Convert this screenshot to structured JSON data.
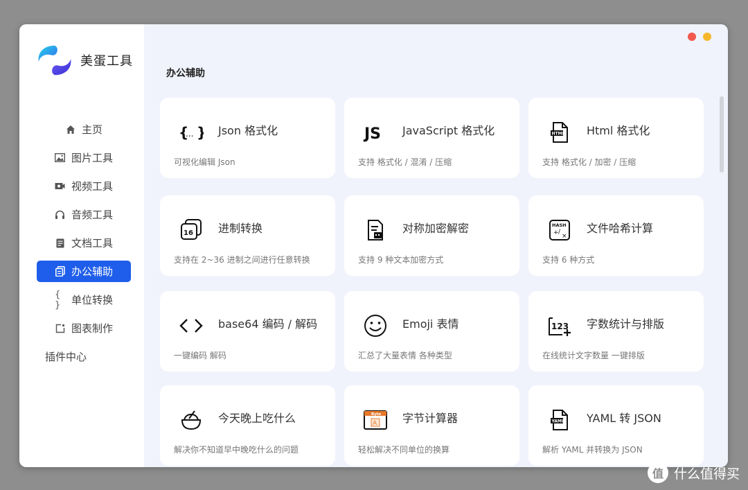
{
  "app": {
    "name": "美蛋工具"
  },
  "window_controls": {
    "close_color": "#f2584e",
    "minimize_color": "#f5b82d"
  },
  "sidebar": {
    "items": [
      {
        "label": "主页",
        "icon": "home-icon"
      },
      {
        "label": "图片工具",
        "icon": "image-icon"
      },
      {
        "label": "视频工具",
        "icon": "video-icon"
      },
      {
        "label": "音频工具",
        "icon": "headphones-icon"
      },
      {
        "label": "文档工具",
        "icon": "document-icon"
      },
      {
        "label": "办公辅助",
        "icon": "copy-icon",
        "active": true
      },
      {
        "label": "单位转换",
        "icon": "braces-icon"
      },
      {
        "label": "图表制作",
        "icon": "chart-icon"
      },
      {
        "label": "插件中心"
      }
    ]
  },
  "main": {
    "section_title": "办公辅助",
    "cards": [
      {
        "title": "Json 格式化",
        "desc": "可视化编辑 Json",
        "icon": "json-braces-icon"
      },
      {
        "title": "JavaScript 格式化",
        "desc": "支持 格式化 / 混淆 / 压缩",
        "icon": "js-icon"
      },
      {
        "title": "Html 格式化",
        "desc": "支持 格式化 / 加密 / 压缩",
        "icon": "html-file-icon"
      },
      {
        "title": "进制转换",
        "desc": "支持在 2~36 进制之间进行任意转换",
        "icon": "base-16-icon"
      },
      {
        "title": "对称加密解密",
        "desc": "支持 9 种文本加密方式",
        "icon": "encrypt-file-icon"
      },
      {
        "title": "文件哈希计算",
        "desc": "支持 6 种方式",
        "icon": "hash-calc-icon"
      },
      {
        "title": "base64 编码 / 解码",
        "desc": "一键编码 解码",
        "icon": "code-brackets-icon"
      },
      {
        "title": "Emoji 表情",
        "desc": "汇总了大量表情 各种类型",
        "icon": "smiley-icon"
      },
      {
        "title": "字数统计与排版",
        "desc": "在线统计文字数量 一键排版",
        "icon": "word-count-icon"
      },
      {
        "title": "今天晚上吃什么",
        "desc": "解决你不知道早中晚吃什么的问题",
        "icon": "food-bowl-icon"
      },
      {
        "title": "字节计算器",
        "desc": "轻松解决不同单位的换算",
        "icon": "byte-calc-icon"
      },
      {
        "title": "YAML 转 JSON",
        "desc": "解析 YAML 并转换为 JSON",
        "icon": "yaml-file-icon"
      }
    ]
  },
  "watermark": {
    "badge": "值",
    "text": "什么值得买"
  }
}
